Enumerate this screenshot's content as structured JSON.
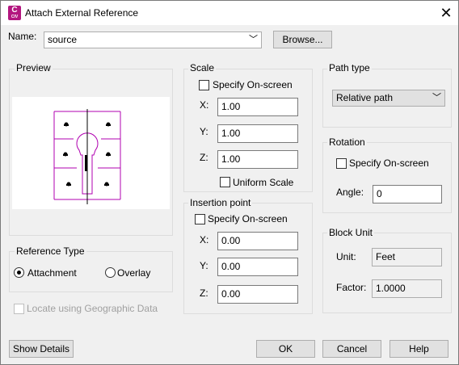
{
  "window": {
    "title": "Attach External Reference",
    "app_icon_letter": "C",
    "app_icon_sub": "CIV"
  },
  "name": {
    "label": "Name:",
    "value": "source",
    "browse_label": "Browse..."
  },
  "preview": {
    "title": "Preview"
  },
  "scale": {
    "title": "Scale",
    "specify_label": "Specify On-screen",
    "x_label": "X:",
    "x_value": "1.00",
    "y_label": "Y:",
    "y_value": "1.00",
    "z_label": "Z:",
    "z_value": "1.00",
    "uniform_label": "Uniform Scale"
  },
  "path_type": {
    "title": "Path type",
    "value": "Relative path"
  },
  "rotation": {
    "title": "Rotation",
    "specify_label": "Specify On-screen",
    "angle_label": "Angle:",
    "angle_value": "0"
  },
  "insertion": {
    "title": "Insertion point",
    "specify_label": "Specify On-screen",
    "x_label": "X:",
    "x_value": "0.00",
    "y_label": "Y:",
    "y_value": "0.00",
    "z_label": "Z:",
    "z_value": "0.00"
  },
  "reference_type": {
    "title": "Reference Type",
    "attachment_label": "Attachment",
    "overlay_label": "Overlay",
    "selected": "attachment"
  },
  "geo": {
    "label": "Locate using Geographic Data"
  },
  "block_unit": {
    "title": "Block Unit",
    "unit_label": "Unit:",
    "unit_value": "Feet",
    "factor_label": "Factor:",
    "factor_value": "1.0000"
  },
  "footer": {
    "details_label": "Show Details",
    "ok_label": "OK",
    "cancel_label": "Cancel",
    "help_label": "Help"
  },
  "colors": {
    "app_icon": "#b3167f",
    "preview_lines": "#b000b0"
  }
}
